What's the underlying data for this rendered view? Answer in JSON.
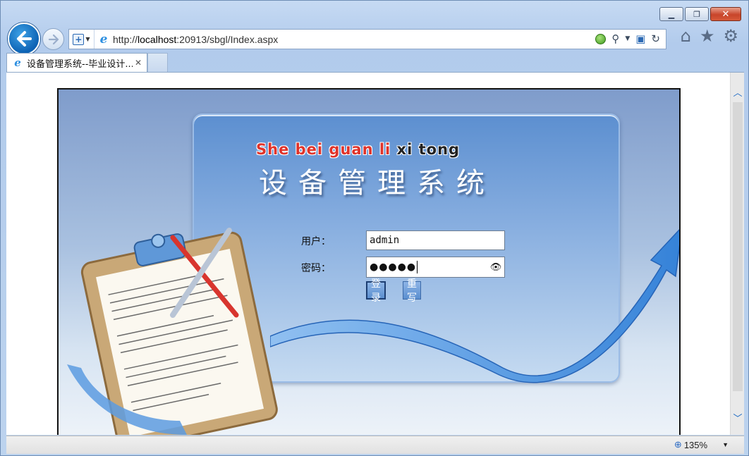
{
  "window": {
    "minimize_glyph": "▁",
    "maximize_glyph": "❐",
    "close_glyph": "✕"
  },
  "nav": {
    "back_icon": "arrow-left-icon",
    "forward_icon": "arrow-right-icon"
  },
  "address": {
    "url_prefix": "http://",
    "url_host": "localhost",
    "url_rest": ":20913/sbgl/Index.aspx"
  },
  "tab": {
    "title": "设备管理系统--毕业设计...",
    "close_glyph": "✕"
  },
  "banner": {
    "pinyin_red": "She bei guan li",
    "pinyin_dark": "xi tong",
    "title": "设备管理系统"
  },
  "login": {
    "user_label": "用户：",
    "user_value": "admin",
    "password_label": "密码：",
    "password_mask": "●●●●●",
    "login_button": "登录",
    "reset_button": "重写"
  },
  "status": {
    "zoom": "135%"
  },
  "colors": {
    "title_red": "#e0332a",
    "panel_blue": "#5c8fd0",
    "button_blue": "#5b8fd0"
  }
}
